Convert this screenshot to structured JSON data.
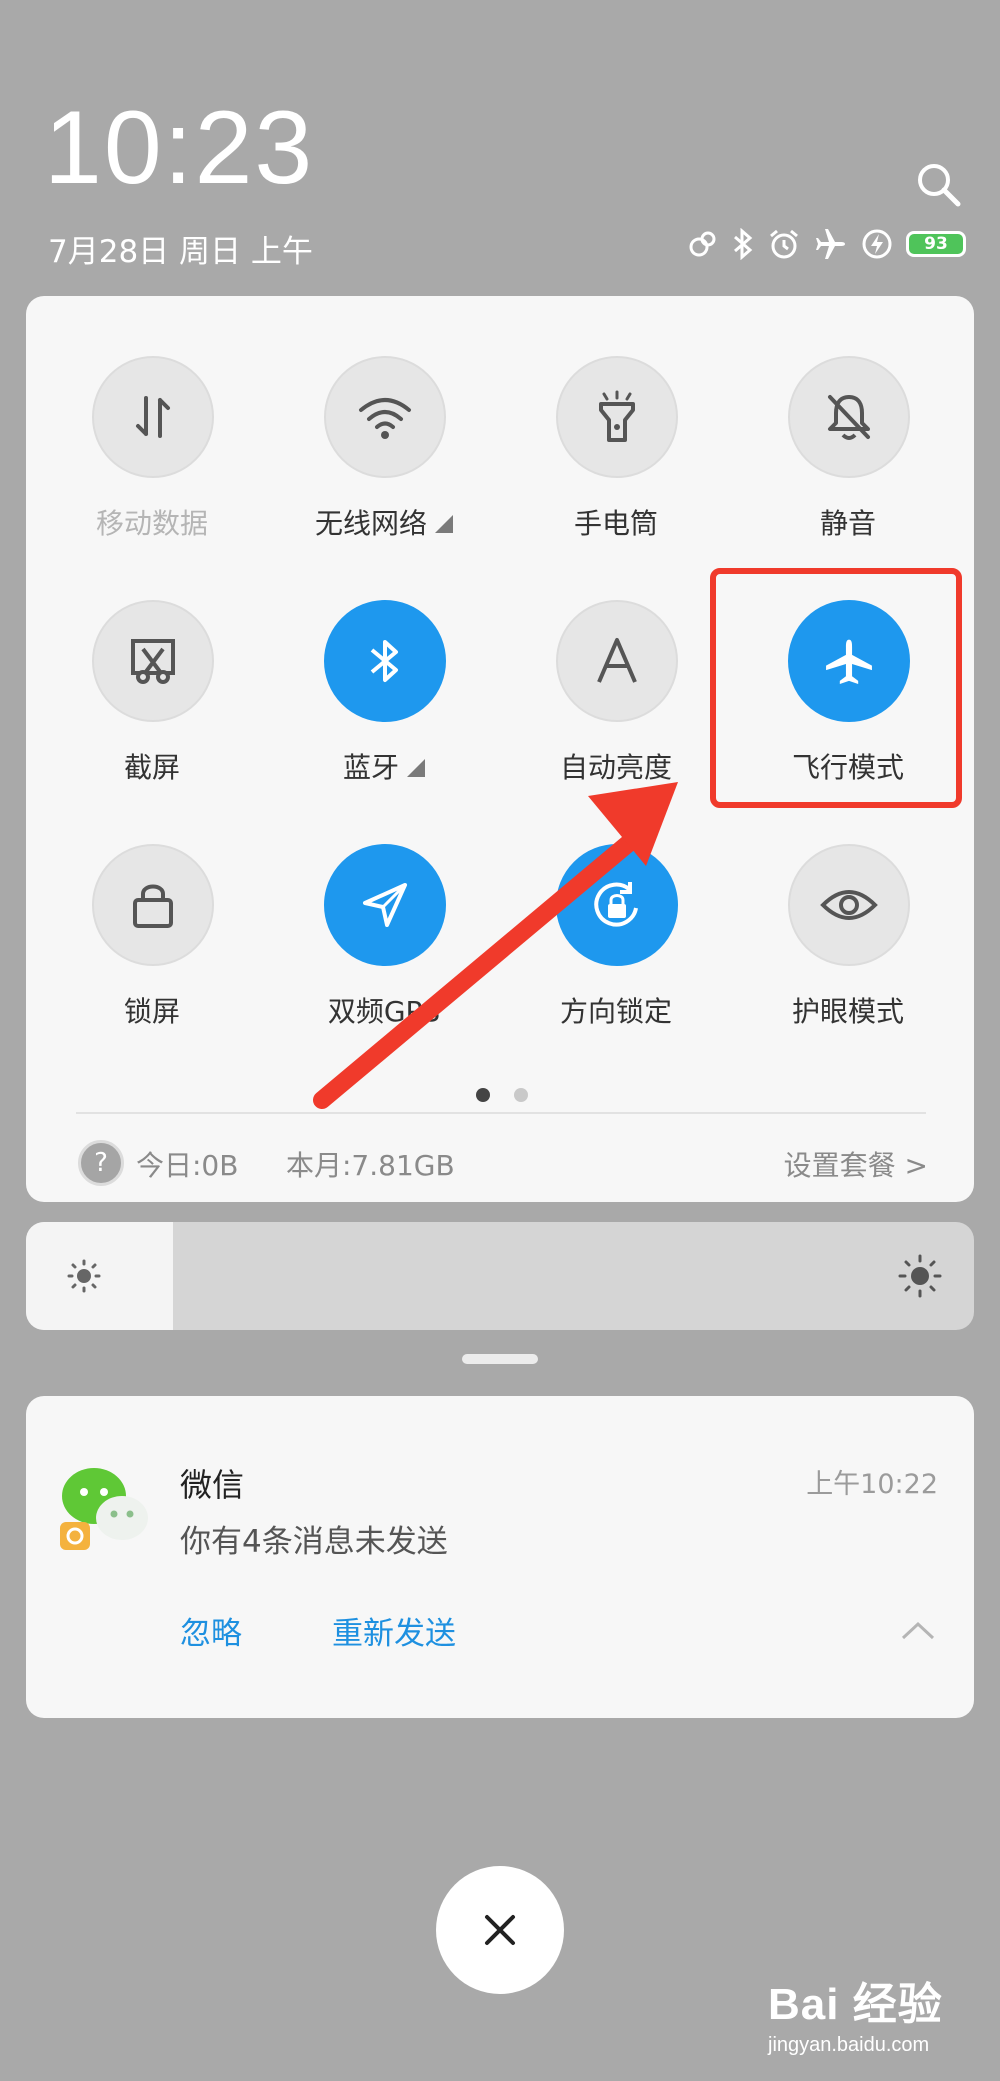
{
  "header": {
    "time": "10:23",
    "date": "7月28日 周日 上午",
    "battery_level": "93",
    "status_icons": [
      "hotspot-icon",
      "bluetooth-icon",
      "alarm-icon",
      "airplane-icon",
      "charging-icon",
      "battery-icon"
    ]
  },
  "quick_settings": {
    "tiles": [
      {
        "id": "mobile-data",
        "label": "移动数据",
        "state": "disabled",
        "icon": "arrows-updown-icon"
      },
      {
        "id": "wifi",
        "label": "无线网络",
        "state": "off",
        "expandable": true,
        "icon": "wifi-icon"
      },
      {
        "id": "flashlight",
        "label": "手电筒",
        "state": "off",
        "icon": "flashlight-icon"
      },
      {
        "id": "silent",
        "label": "静音",
        "state": "off",
        "icon": "bell-off-icon"
      },
      {
        "id": "screenshot",
        "label": "截屏",
        "state": "off",
        "icon": "scissors-icon"
      },
      {
        "id": "bluetooth",
        "label": "蓝牙",
        "state": "on",
        "expandable": true,
        "icon": "bluetooth-icon"
      },
      {
        "id": "auto-brightness",
        "label": "自动亮度",
        "state": "off",
        "icon": "letter-a-icon"
      },
      {
        "id": "airplane",
        "label": "飞行模式",
        "state": "on",
        "icon": "airplane-icon"
      },
      {
        "id": "lock-screen",
        "label": "锁屏",
        "state": "off",
        "icon": "lock-icon"
      },
      {
        "id": "gps",
        "label": "双频GPS",
        "state": "on",
        "icon": "navigation-icon"
      },
      {
        "id": "rotation-lock",
        "label": "方向锁定",
        "state": "on",
        "icon": "rotation-lock-icon"
      },
      {
        "id": "eye-care",
        "label": "护眼模式",
        "state": "off",
        "icon": "eye-icon"
      }
    ],
    "pages": 2,
    "current_page": 1,
    "data_usage": {
      "help": "?",
      "today": "今日:0B",
      "month": "本月:7.81GB",
      "plan_link": "设置套餐 >"
    }
  },
  "brightness": {
    "level": 0.155
  },
  "notification": {
    "app": "微信",
    "message": "你有4条消息未发送",
    "time": "上午10:22",
    "actions": {
      "ignore": "忽略",
      "resend": "重新发送"
    }
  },
  "close_icon": "close-icon",
  "colors": {
    "accent": "#1e98ee",
    "annotation": "#f03a2b",
    "battery": "#4fc45a",
    "link": "#1e90e0"
  },
  "watermark": {
    "logo": "Bai 经验",
    "url": "jingyan.baidu.com"
  }
}
